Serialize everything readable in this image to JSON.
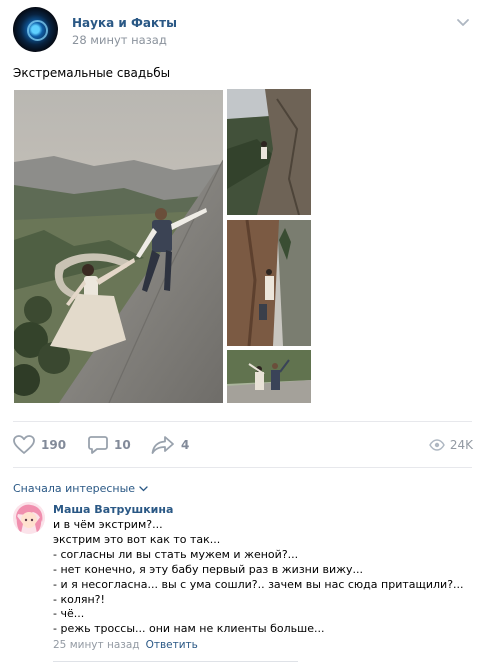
{
  "post": {
    "author": "Наука и Факты",
    "time": "28 минут назад",
    "text": "Экстремальные свадьбы",
    "likes": "190",
    "comments": "10",
    "shares": "4",
    "views": "24K"
  },
  "comments_section": {
    "sort_label": "Сначала интересные",
    "items": [
      {
        "author": "Маша Ватрушкина",
        "lines": [
          "и в чём экстрим?...",
          "экстрим это вот как то так...",
          "- согласны ли вы стать мужем и женой?...",
          "- нет конечно, я эту бабу первый раз в жизни вижу...",
          "- и я несогласна... вы с ума сошли?.. зачем вы нас сюда притащили?...",
          "- колян?!",
          "- чё...",
          "- режь троссы... они нам не клиенты больше..."
        ],
        "time": "25 минут назад",
        "reply": "Ответить"
      }
    ]
  },
  "colors": {
    "link": "#2a5885",
    "muted": "#828a99",
    "divider": "#e7e8ec"
  },
  "icons": {
    "like": "heart-icon",
    "comment": "comment-icon",
    "share": "share-arrow-icon",
    "views": "eye-icon",
    "menu": "chevron-down-icon"
  }
}
